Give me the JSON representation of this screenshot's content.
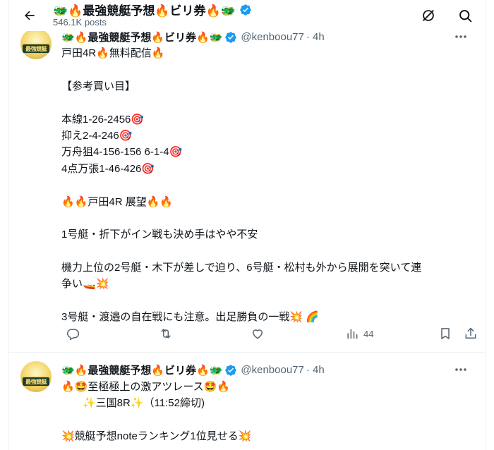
{
  "header": {
    "title": "🐲🔥最強競艇予想🔥ビリ券🔥🐲",
    "posts_count": "546.1K posts"
  },
  "tweets": [
    {
      "avatar_text": "最強競艇",
      "name": "🐲🔥最強競艇予想🔥ビリ券🔥🐲",
      "handle": "@kenboou77",
      "time": "· 4h",
      "lines": [
        "戸田4R🔥無料配信🔥",
        "",
        "【参考買い目】",
        "",
        "本線1-26-2456🎯",
        " 抑え2-4-246🎯",
        " 万舟狙4-156-156 6-1-4🎯",
        " 4点万張1-46-426🎯",
        "",
        "🔥🔥戸田4R 展望🔥🔥",
        "",
        "1号艇・折下がイン戦も決め手はやや不安",
        "",
        "機力上位の2号艇・木下が差しで迫り、6号艇・松村も外から展開を突いて連",
        "争い🚤💥",
        "",
        "3号艇・渡邉の自在戦にも注意。出足勝負の一戦💥 🌈"
      ],
      "stats": {
        "views": "44"
      }
    },
    {
      "avatar_text": "最強競艇",
      "name": "🐲🔥最強競艇予想🔥ビリ券🔥🐲",
      "handle": "@kenboou77",
      "time": "· 4h",
      "lines": [
        "🔥🤩至極極上の激アツレース🤩🔥",
        "　　✨三国8R✨（11:52締切)",
        "",
        "💥競艇予想noteランキング1位見せる💥"
      ]
    }
  ],
  "colors": {
    "text": "#0f1419",
    "muted": "#536471",
    "verified": "#1d9bf0",
    "border": "#eff3f4"
  }
}
